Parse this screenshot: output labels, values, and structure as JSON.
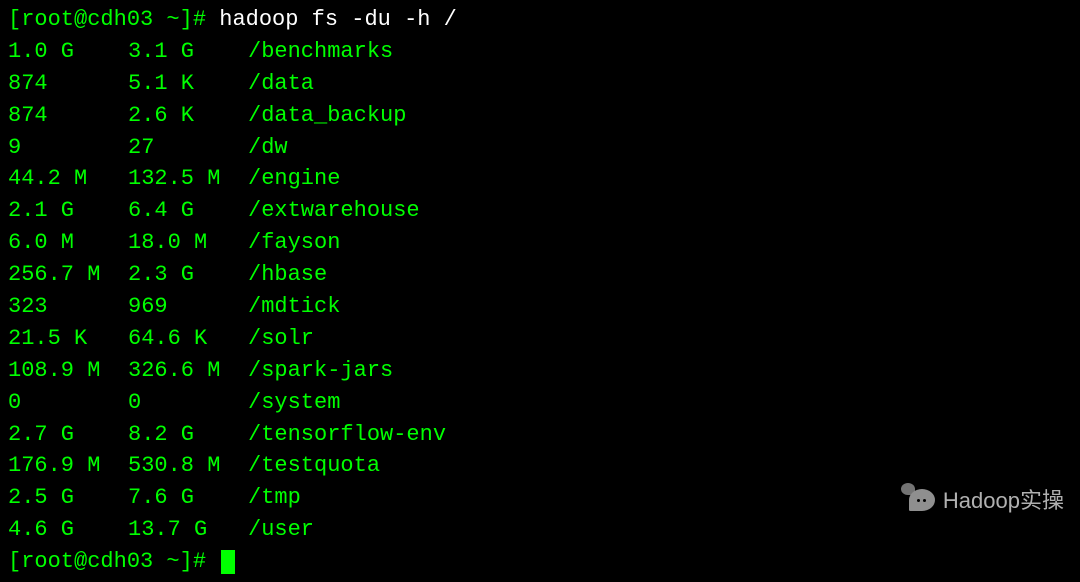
{
  "prompt1": {
    "user_host": "[root@cdh03 ~]#",
    "command": "hadoop fs -du -h /"
  },
  "rows": [
    {
      "size": "1.0 G",
      "dsize": "3.1 G",
      "path": "/benchmarks"
    },
    {
      "size": "874",
      "dsize": "5.1 K",
      "path": "/data"
    },
    {
      "size": "874",
      "dsize": "2.6 K",
      "path": "/data_backup"
    },
    {
      "size": "9",
      "dsize": "27",
      "path": "/dw"
    },
    {
      "size": "44.2 M",
      "dsize": "132.5 M",
      "path": "/engine"
    },
    {
      "size": "2.1 G",
      "dsize": "6.4 G",
      "path": "/extwarehouse"
    },
    {
      "size": "6.0 M",
      "dsize": "18.0 M",
      "path": "/fayson"
    },
    {
      "size": "256.7 M",
      "dsize": "2.3 G",
      "path": "/hbase"
    },
    {
      "size": "323",
      "dsize": "969",
      "path": "/mdtick"
    },
    {
      "size": "21.5 K",
      "dsize": "64.6 K",
      "path": "/solr"
    },
    {
      "size": "108.9 M",
      "dsize": "326.6 M",
      "path": "/spark-jars"
    },
    {
      "size": "0",
      "dsize": "0",
      "path": "/system"
    },
    {
      "size": "2.7 G",
      "dsize": "8.2 G",
      "path": "/tensorflow-env"
    },
    {
      "size": "176.9 M",
      "dsize": "530.8 M",
      "path": "/testquota"
    },
    {
      "size": "2.5 G",
      "dsize": "7.6 G",
      "path": "/tmp"
    },
    {
      "size": "4.6 G",
      "dsize": "13.7 G",
      "path": "/user"
    }
  ],
  "prompt2": {
    "user_host": "[root@cdh03 ~]#"
  },
  "watermark": {
    "text": "Hadoop实操"
  }
}
